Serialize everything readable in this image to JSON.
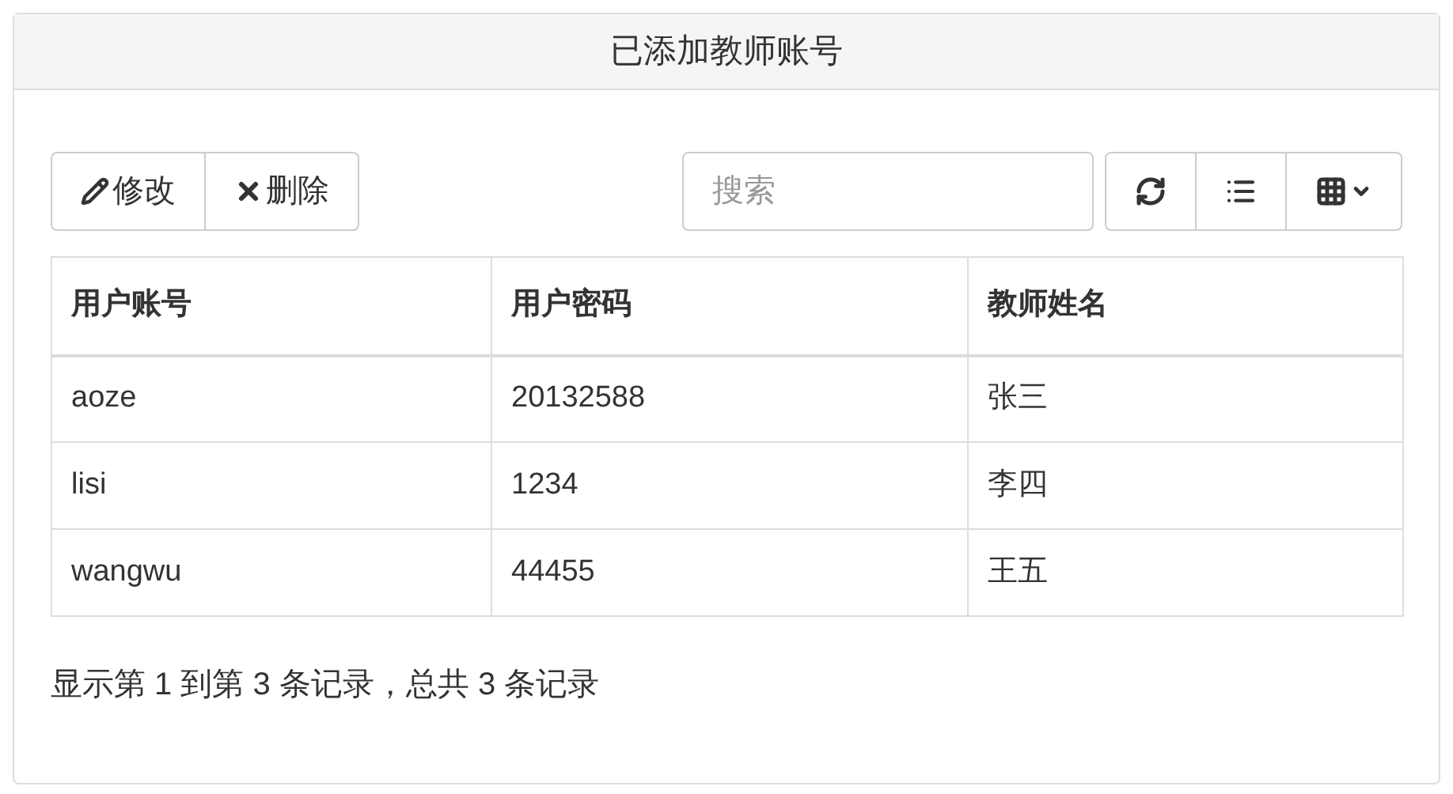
{
  "panel": {
    "title": "已添加教师账号"
  },
  "toolbar": {
    "actions": [
      {
        "kind": "edit",
        "label": "修改"
      },
      {
        "kind": "delete",
        "label": "删除"
      }
    ],
    "search": {
      "placeholder": "搜索"
    },
    "tools": [
      {
        "kind": "refresh"
      },
      {
        "kind": "list"
      },
      {
        "kind": "columns"
      }
    ]
  },
  "table": {
    "columns": [
      "用户账号",
      "用户密码",
      "教师姓名"
    ],
    "rows": [
      [
        "aoze",
        "20132588",
        "张三"
      ],
      [
        "lisi",
        "1234",
        "李四"
      ],
      [
        "wangwu",
        "44455",
        "王五"
      ]
    ]
  },
  "pagination": {
    "summary": "显示第 1 到第 3 条记录，总共 3 条记录"
  }
}
